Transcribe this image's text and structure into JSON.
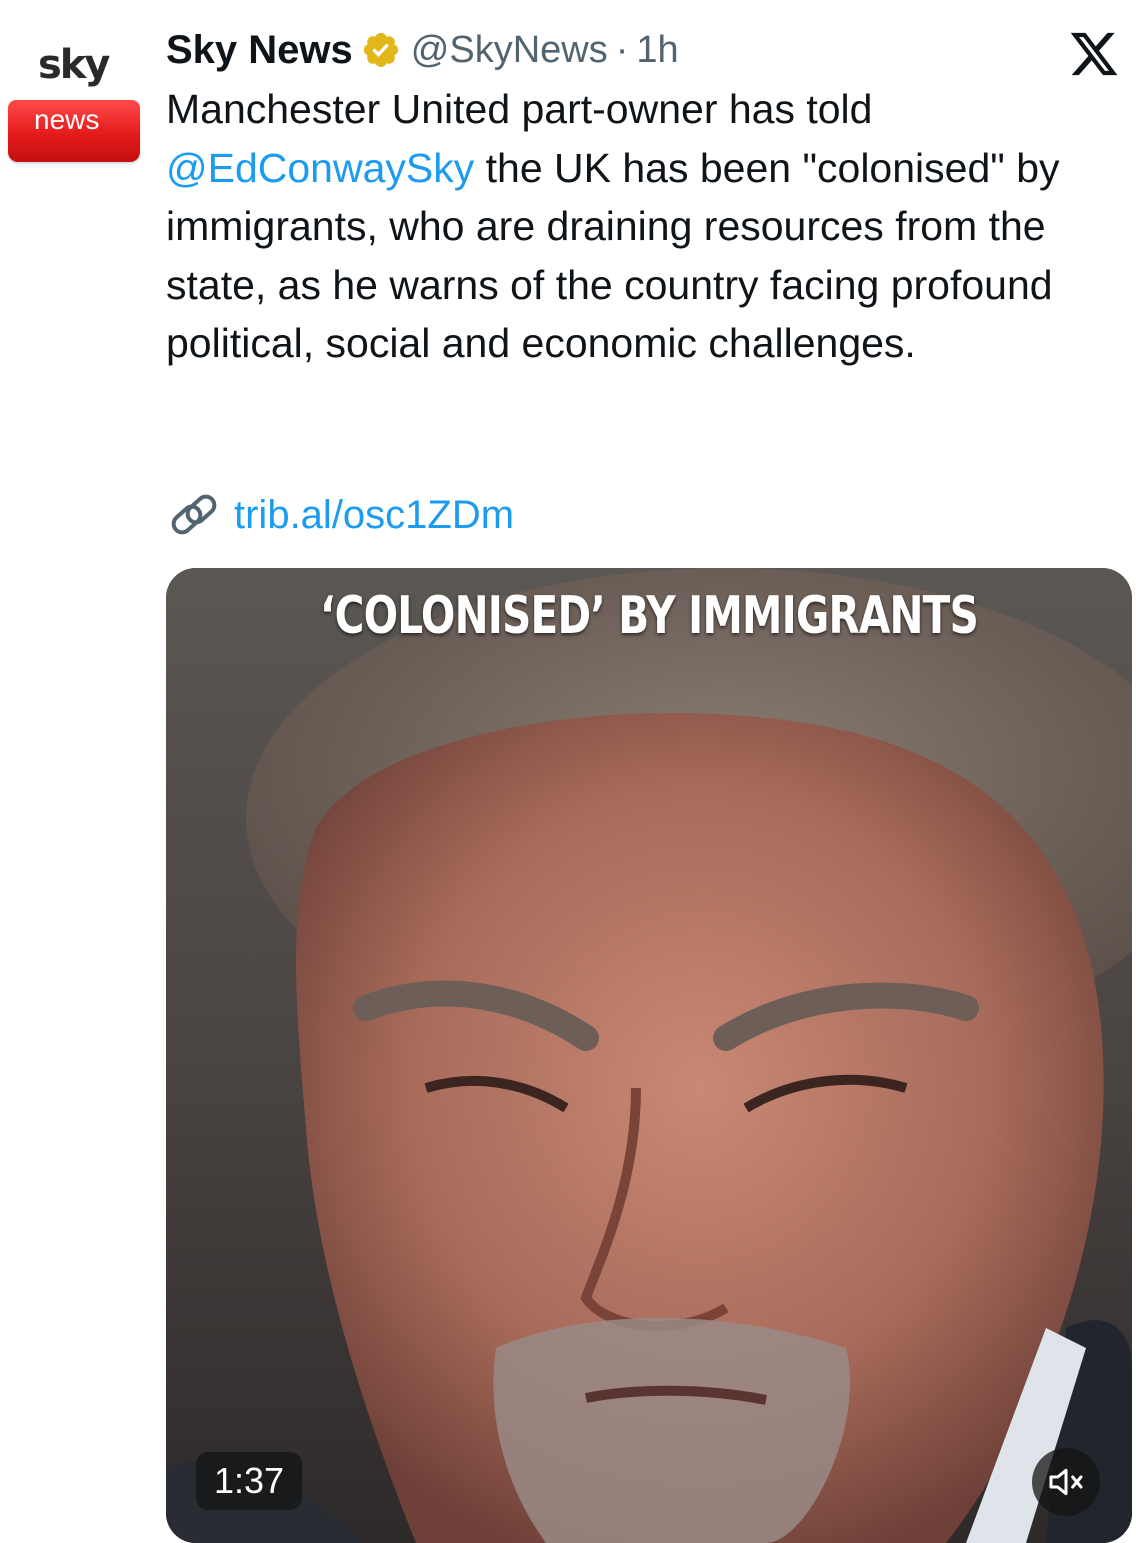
{
  "author": {
    "avatar_top_text": "sky",
    "avatar_bottom_text": "news",
    "display_name": "Sky News",
    "handle": "@SkyNews",
    "separator": "·",
    "time": "1h",
    "verified_badge": "gold-check",
    "avatar_red": "#e41b1b"
  },
  "tweet": {
    "text_before_mention": "Manchester United part-owner has told ",
    "mention": "@EdConwaySky",
    "text_after_mention": " the UK has been \"colonised\" by immigrants, who are draining resources from the state, as he warns of the country facing profound political, social and economic challenges.",
    "link_icon": "link-icon",
    "link_text": "trib.al/osc1ZDm"
  },
  "video": {
    "caption": "‘COLONISED’ BY IMMIGRANTS",
    "duration": "1:37",
    "mute_icon": "speaker-muted-icon"
  },
  "colors": {
    "link_blue": "#1d9bf0",
    "secondary_text": "#536471",
    "primary_text": "#0f1419",
    "verified_gold": "#e2b719"
  },
  "brand_icon": "x-logo-icon"
}
